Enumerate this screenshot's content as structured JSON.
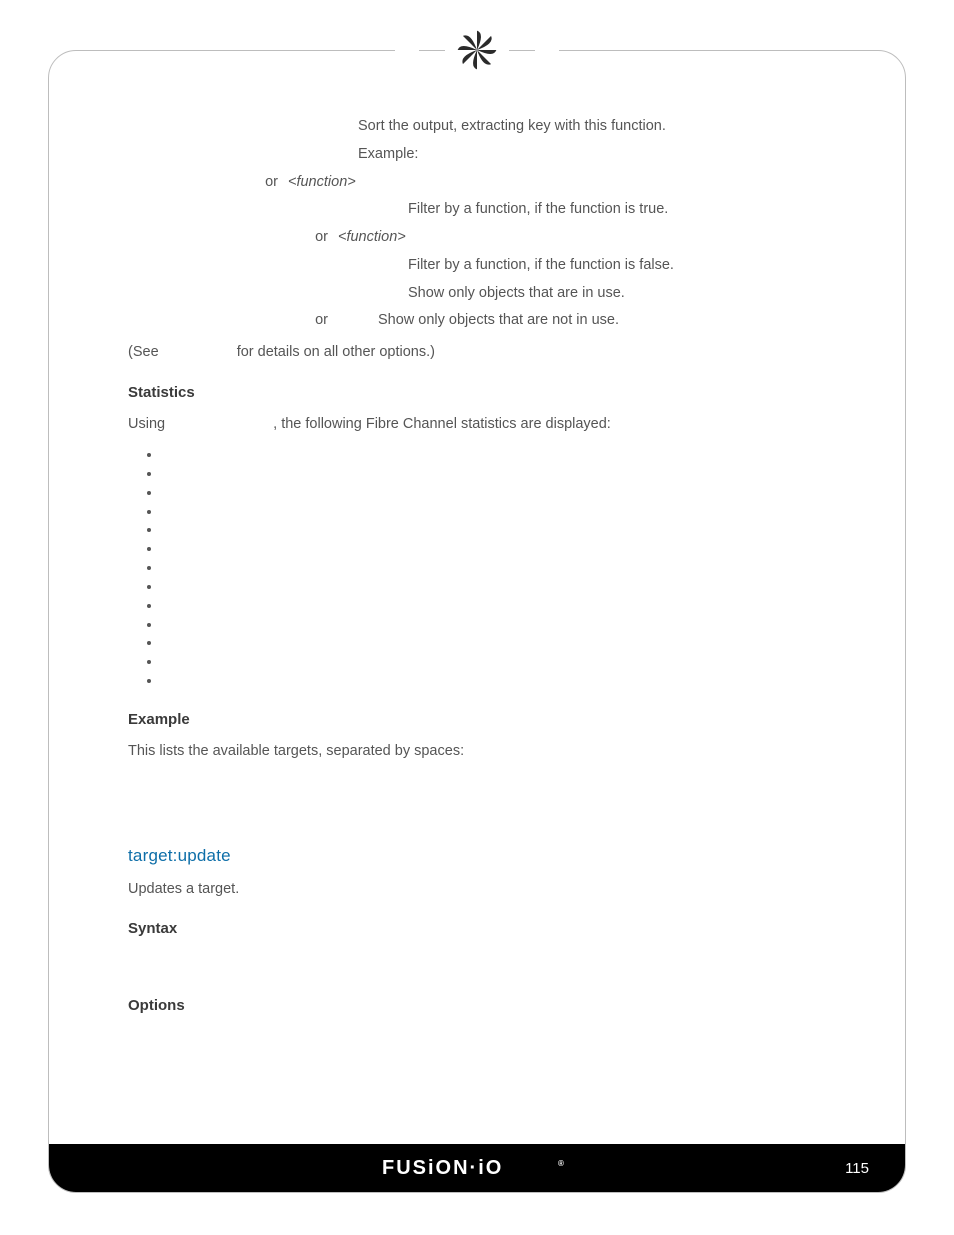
{
  "options": [
    {
      "desc1": "Sort the output, extracting key with this function.",
      "desc2": "Example:"
    },
    {
      "or": "or",
      "arg": "<function>",
      "desc": "Filter by a function, if the function is true."
    },
    {
      "or": "or",
      "arg": "<function>",
      "desc": "Filter by a function, if the function is false."
    },
    {
      "desc_only": "Show only objects that are in use."
    },
    {
      "or": "or",
      "desc": "Show only objects that are not in use."
    }
  ],
  "see_line": {
    "prefix": "(See",
    "suffix": " for details on all other options.)"
  },
  "stats_head": "Statistics",
  "stats_intro_1": "Using ",
  "stats_intro_2": ", the following Fibre Channel statistics are displayed:",
  "stats_items": [
    "",
    "",
    "",
    "",
    "",
    "",
    "",
    "",
    "",
    "",
    "",
    "",
    ""
  ],
  "example_head": "Example",
  "example_text": "This lists the available targets, separated by spaces:",
  "target_update": {
    "title": "target:update",
    "desc": "Updates a target.",
    "syntax_head": "Syntax",
    "options_head": "Options"
  },
  "footer": {
    "brand": "FUSION·IO",
    "reg": "®",
    "page": "115"
  }
}
